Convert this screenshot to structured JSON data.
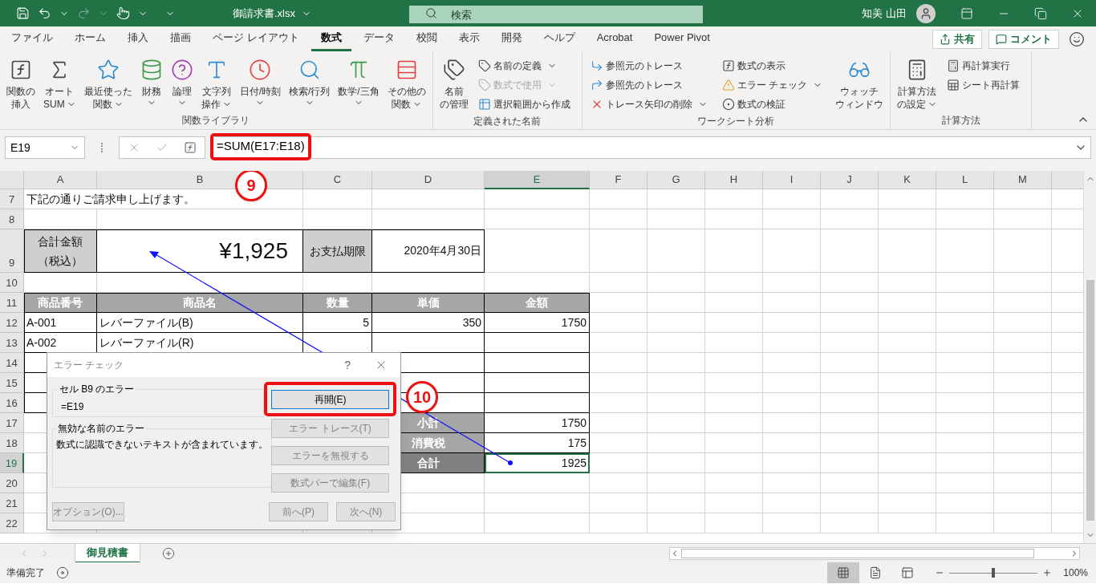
{
  "titlebar": {
    "filename": "御請求書.xlsx",
    "search_placeholder": "検索",
    "user": "知美 山田"
  },
  "menu_tabs": [
    {
      "label": "ファイル",
      "selected": false
    },
    {
      "label": "ホーム",
      "selected": false
    },
    {
      "label": "挿入",
      "selected": false
    },
    {
      "label": "描画",
      "selected": false
    },
    {
      "label": "ページ レイアウト",
      "selected": false
    },
    {
      "label": "数式",
      "selected": true
    },
    {
      "label": "データ",
      "selected": false
    },
    {
      "label": "校閲",
      "selected": false
    },
    {
      "label": "表示",
      "selected": false
    },
    {
      "label": "開発",
      "selected": false
    },
    {
      "label": "ヘルプ",
      "selected": false
    },
    {
      "label": "Acrobat",
      "selected": false
    },
    {
      "label": "Power Pivot",
      "selected": false
    }
  ],
  "share_button": "共有",
  "comment_button": "コメント",
  "ribbon_groups": [
    {
      "label": "関数ライブラリ",
      "items": [
        {
          "kind": "large",
          "lines": [
            "関数の",
            "挿入"
          ],
          "dropdown": false
        },
        {
          "kind": "large",
          "lines": [
            "オート",
            "SUM"
          ],
          "dropdown": true
        },
        {
          "kind": "large",
          "lines": [
            "最近使った",
            "関数"
          ],
          "dropdown": true
        },
        {
          "kind": "large",
          "lines": [
            "財務"
          ],
          "dropdown": true
        },
        {
          "kind": "large",
          "lines": [
            "論理"
          ],
          "dropdown": true
        },
        {
          "kind": "large",
          "lines": [
            "文字列",
            "操作"
          ],
          "dropdown": true
        },
        {
          "kind": "large",
          "lines": [
            "日付/時刻"
          ],
          "dropdown": true
        },
        {
          "kind": "large",
          "lines": [
            "検索/行列"
          ],
          "dropdown": true
        },
        {
          "kind": "large",
          "lines": [
            "数学/三角"
          ],
          "dropdown": true
        },
        {
          "kind": "large",
          "lines": [
            "その他の",
            "関数"
          ],
          "dropdown": true
        }
      ]
    },
    {
      "label": "定義された名前",
      "items": [
        {
          "kind": "large",
          "lines": [
            "名前",
            "の管理"
          ],
          "dropdown": false
        },
        {
          "kind": "small",
          "label": "名前の定義",
          "dropdown": true,
          "disabled": false
        },
        {
          "kind": "small",
          "label": "数式で使用",
          "dropdown": true,
          "disabled": true
        },
        {
          "kind": "small",
          "label": "選択範囲から作成",
          "dropdown": false,
          "disabled": false
        }
      ]
    },
    {
      "label": "ワークシート分析",
      "items": [
        {
          "kind": "small",
          "label": "参照元のトレース",
          "dropdown": false,
          "disabled": false
        },
        {
          "kind": "small",
          "label": "参照先のトレース",
          "dropdown": false,
          "disabled": false
        },
        {
          "kind": "small",
          "label": "トレース矢印の削除",
          "dropdown": true,
          "disabled": false
        },
        {
          "kind": "small",
          "label": "数式の表示",
          "dropdown": false,
          "disabled": false
        },
        {
          "kind": "small",
          "label": "エラー チェック",
          "dropdown": true,
          "disabled": false
        },
        {
          "kind": "small",
          "label": "数式の検証",
          "dropdown": false,
          "disabled": false
        },
        {
          "kind": "large",
          "lines": [
            "ウォッチ",
            "ウィンドウ"
          ],
          "dropdown": false
        }
      ]
    },
    {
      "label": "計算方法",
      "items": [
        {
          "kind": "large",
          "lines": [
            "計算方法",
            "の設定"
          ],
          "dropdown": true
        },
        {
          "kind": "small",
          "label": "再計算実行",
          "dropdown": false,
          "disabled": false
        },
        {
          "kind": "small",
          "label": "シート再計算",
          "dropdown": false,
          "disabled": false
        }
      ]
    }
  ],
  "formula_bar": {
    "name_box": "E19",
    "formula": "=SUM(E17:E18)"
  },
  "sheet": {
    "columns": [
      {
        "label": "A",
        "selected": false
      },
      {
        "label": "B",
        "selected": false
      },
      {
        "label": "C",
        "selected": false
      },
      {
        "label": "D",
        "selected": false
      },
      {
        "label": "E",
        "selected": true
      },
      {
        "label": "F",
        "selected": false
      },
      {
        "label": "G",
        "selected": false
      },
      {
        "label": "H",
        "selected": false
      },
      {
        "label": "I",
        "selected": false
      },
      {
        "label": "J",
        "selected": false
      },
      {
        "label": "K",
        "selected": false
      },
      {
        "label": "L",
        "selected": false
      },
      {
        "label": "M",
        "selected": false
      }
    ],
    "rows": [
      {
        "label": "7",
        "selected": false,
        "cells": [
          {
            "kind": "wide",
            "text": "下記の通りご請求申し上げます。"
          },
          {
            "kind": "plain"
          },
          {
            "kind": "plain"
          },
          {
            "kind": "plain"
          }
        ]
      },
      {
        "label": "8",
        "selected": false,
        "cells": [
          {
            "kind": "plain"
          },
          {
            "kind": "plain"
          },
          {
            "kind": "plain"
          },
          {
            "kind": "plain"
          },
          {
            "kind": "plain"
          }
        ]
      },
      {
        "label": "9",
        "selected": false,
        "cells": [
          {
            "kind": "label",
            "lines": [
              "合計金額",
              "（税込）"
            ]
          },
          {
            "kind": "big",
            "text": "¥1,925"
          },
          {
            "kind": "label",
            "text": "お支払期限"
          },
          {
            "kind": "number",
            "text": "2020年4月30日"
          },
          {
            "kind": "plain"
          }
        ]
      },
      {
        "label": "10",
        "selected": false,
        "cells": [
          {
            "kind": "plain"
          },
          {
            "kind": "plain"
          },
          {
            "kind": "plain"
          },
          {
            "kind": "plain"
          },
          {
            "kind": "plain"
          }
        ]
      },
      {
        "label": "11",
        "selected": false,
        "cells": [
          {
            "kind": "head",
            "text": "商品番号"
          },
          {
            "kind": "head",
            "text": "商品名"
          },
          {
            "kind": "head",
            "text": "数量"
          },
          {
            "kind": "head",
            "text": "単価"
          },
          {
            "kind": "head",
            "text": "金額"
          }
        ]
      },
      {
        "label": "12",
        "selected": false,
        "cells": [
          {
            "kind": "text",
            "text": "A-001"
          },
          {
            "kind": "text",
            "text": "レバーファイル(B)"
          },
          {
            "kind": "number",
            "text": "5"
          },
          {
            "kind": "number",
            "text": "350"
          },
          {
            "kind": "number",
            "text": "1750"
          }
        ]
      },
      {
        "label": "13",
        "selected": false,
        "cells": [
          {
            "kind": "text",
            "text": "A-002"
          },
          {
            "kind": "text",
            "text": "レバーファイル(R)"
          },
          {
            "kind": "text"
          },
          {
            "kind": "text"
          },
          {
            "kind": "text"
          }
        ]
      },
      {
        "label": "14",
        "selected": false,
        "cells": [
          {
            "kind": "text"
          },
          {
            "kind": "text"
          },
          {
            "kind": "text"
          },
          {
            "kind": "text"
          },
          {
            "kind": "text"
          }
        ]
      },
      {
        "label": "15",
        "selected": false,
        "cells": [
          {
            "kind": "text"
          },
          {
            "kind": "text"
          },
          {
            "kind": "text"
          },
          {
            "kind": "text"
          },
          {
            "kind": "text"
          }
        ]
      },
      {
        "label": "16",
        "selected": false,
        "cells": [
          {
            "kind": "text"
          },
          {
            "kind": "text"
          },
          {
            "kind": "text"
          },
          {
            "kind": "text"
          },
          {
            "kind": "text"
          }
        ]
      },
      {
        "label": "17",
        "selected": false,
        "cells": [
          {
            "kind": "plain"
          },
          {
            "kind": "plain"
          },
          {
            "kind": "plain"
          },
          {
            "kind": "head",
            "text": "小計"
          },
          {
            "kind": "number",
            "text": "1750"
          }
        ]
      },
      {
        "label": "18",
        "selected": false,
        "cells": [
          {
            "kind": "plain"
          },
          {
            "kind": "plain"
          },
          {
            "kind": "plain"
          },
          {
            "kind": "head",
            "text": "消費税"
          },
          {
            "kind": "number",
            "text": "175"
          }
        ]
      },
      {
        "label": "19",
        "selected": true,
        "cells": [
          {
            "kind": "plain"
          },
          {
            "kind": "plain"
          },
          {
            "kind": "plain"
          },
          {
            "kind": "head_dark",
            "text": "合計"
          },
          {
            "kind": "number",
            "text": "1925"
          }
        ]
      },
      {
        "label": "20",
        "selected": false,
        "cells": [
          {
            "kind": "plain"
          },
          {
            "kind": "plain"
          },
          {
            "kind": "plain"
          },
          {
            "kind": "plain"
          },
          {
            "kind": "plain"
          }
        ]
      },
      {
        "label": "21",
        "selected": false,
        "cells": [
          {
            "kind": "plain"
          },
          {
            "kind": "plain"
          },
          {
            "kind": "plain"
          },
          {
            "kind": "plain"
          },
          {
            "kind": "plain"
          }
        ]
      },
      {
        "label": "22",
        "selected": false,
        "cells": [
          {
            "kind": "plain"
          },
          {
            "kind": "plain"
          },
          {
            "kind": "plain"
          },
          {
            "kind": "plain"
          },
          {
            "kind": "plain"
          }
        ]
      }
    ]
  },
  "dialog": {
    "title": "エラー チェック",
    "help": "?",
    "error_group": {
      "legend": "セル B9 のエラー",
      "formula": "=E19"
    },
    "message_group": {
      "legend": "無効な名前のエラー",
      "text": "数式に認識できないテキストが含まれています。"
    },
    "buttons": [
      {
        "label": "再開(E)",
        "disabled": false
      },
      {
        "label": "エラー トレース(T)",
        "disabled": true
      },
      {
        "label": "エラーを無視する",
        "disabled": true
      },
      {
        "label": "数式バーで編集(F)",
        "disabled": true
      }
    ],
    "footer_buttons": [
      {
        "label": "オプション(O)...",
        "disabled": true
      },
      {
        "label": "前へ(P)",
        "disabled": true
      },
      {
        "label": "次へ(N)",
        "disabled": true
      }
    ]
  },
  "annotations": [
    {
      "label": "9"
    },
    {
      "label": "10"
    }
  ],
  "sheet_tabs": [
    {
      "label": "御見積書",
      "selected": true
    }
  ],
  "status_bar": {
    "status": "準備完了",
    "views": [
      {
        "selected": true
      },
      {
        "selected": false
      },
      {
        "selected": false
      }
    ],
    "zoom": {
      "level": 0.5
    },
    "zoom_label": "100%"
  }
}
